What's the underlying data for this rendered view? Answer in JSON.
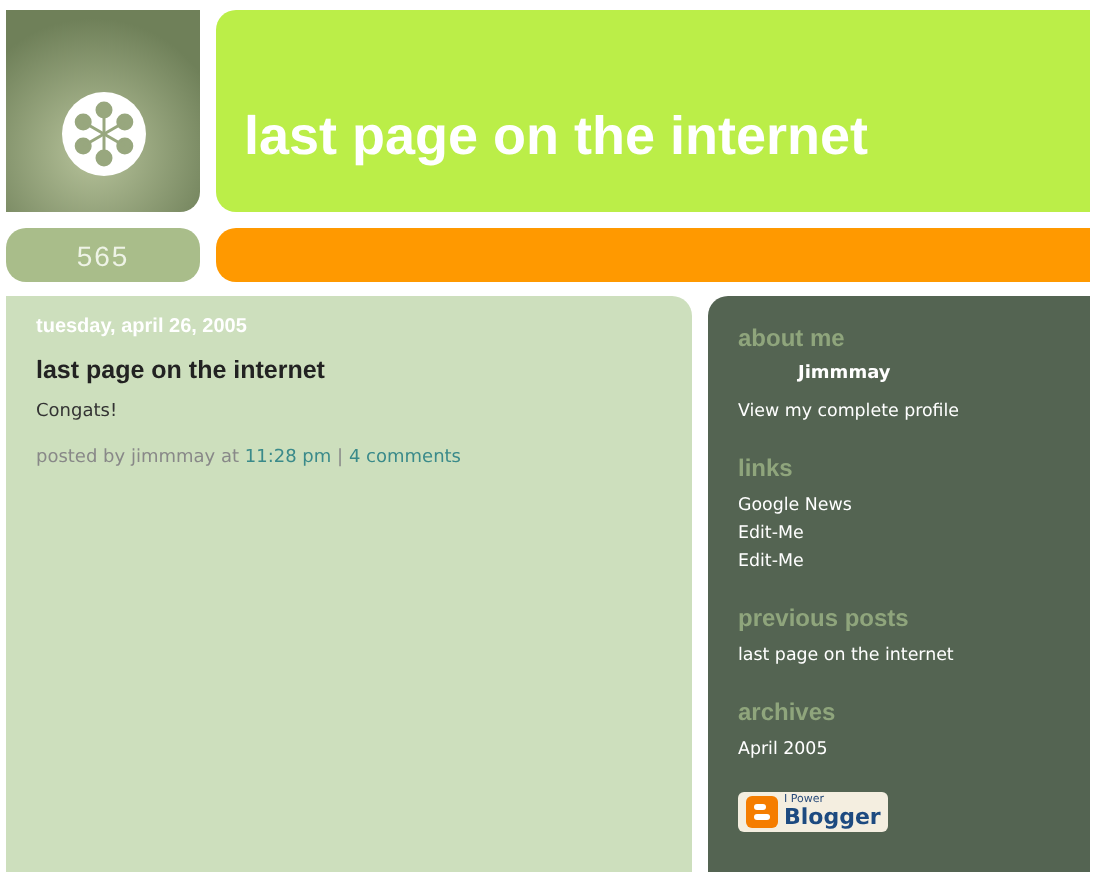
{
  "header": {
    "title": "last page on the internet"
  },
  "tab_label": "565",
  "post": {
    "date": "tuesday, april 26, 2005",
    "title": "last page on the internet",
    "body": "Congats!",
    "byline": "posted by jimmmay at",
    "time": "11:28 pm",
    "separator": "|",
    "comments": "4 comments"
  },
  "sidebar": {
    "sections": [
      {
        "heading": "about me",
        "kind": "profile",
        "name": "Jimmmay",
        "items": [
          "View my complete profile"
        ]
      },
      {
        "heading": "links",
        "kind": "list",
        "items": [
          "Google News",
          "Edit-Me",
          "Edit-Me"
        ]
      },
      {
        "heading": "previous posts",
        "kind": "list",
        "items": [
          "last page on the internet"
        ]
      },
      {
        "heading": "archives",
        "kind": "list",
        "items": [
          "April 2005"
        ]
      }
    ],
    "badge": {
      "top": "I Power",
      "bottom": "Blogger"
    }
  }
}
